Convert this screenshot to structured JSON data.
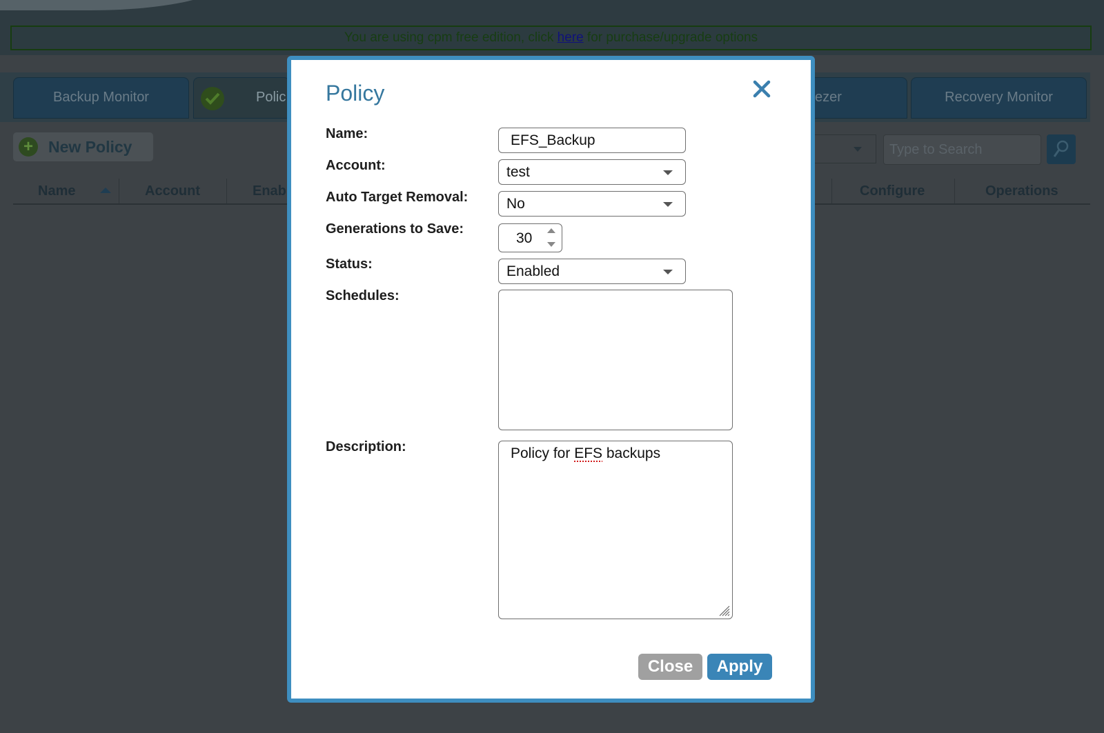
{
  "banner": {
    "prefix": "You are using cpm free edition, click ",
    "link": "here",
    "suffix": " for purchase/upgrade options"
  },
  "tabs": [
    {
      "label": "Backup Monitor"
    },
    {
      "label": "Polic"
    },
    {
      "label": "ezer"
    },
    {
      "label": "Recovery Monitor"
    }
  ],
  "toolbar": {
    "new_policy": "New Policy",
    "search_placeholder": "Type to Search"
  },
  "table": {
    "headers": [
      "Name",
      "Account",
      "Enab",
      "Configure",
      "Operations"
    ]
  },
  "modal": {
    "title": "Policy",
    "fields": {
      "name": {
        "label": "Name:",
        "value": "EFS_Backup"
      },
      "account": {
        "label": "Account:",
        "value": "test"
      },
      "auto_target_removal": {
        "label": "Auto Target Removal:",
        "value": "No"
      },
      "generations": {
        "label": "Generations to Save:",
        "value": "30"
      },
      "status": {
        "label": "Status:",
        "value": "Enabled"
      },
      "schedules": {
        "label": "Schedules:"
      },
      "description": {
        "label": "Description:",
        "pre": "Policy for ",
        "mid": "EFS",
        "post": " backups"
      }
    },
    "buttons": {
      "close": "Close",
      "apply": "Apply"
    }
  },
  "colors": {
    "accent": "#3a85b7",
    "modal_border": "#3e8ec0",
    "title": "#35779e",
    "close_button": "#a0a0a0"
  },
  "icons": {
    "close": "x-icon",
    "search": "magnifier-icon",
    "check": "checkmark-icon",
    "add": "plus-icon"
  }
}
